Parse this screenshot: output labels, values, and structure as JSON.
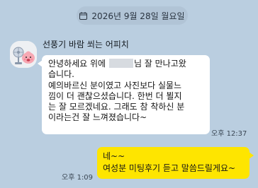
{
  "date_divider": {
    "icon": "calendar-icon",
    "text": "2026년 9월 28일 월요일"
  },
  "incoming": {
    "sender": "선풍기 바람 쐬는 어피치",
    "avatar_icon": "apeach-with-fan-avatar",
    "lines": [
      [
        "안녕하세요 위에",
        "님 잘 만나고왔"
      ],
      "습니다.",
      "예의바르신 분이였고 사진보다 실물느",
      "낌이 더 괜찮으셨습니다. 한번 더 뵐지",
      "는 잘 모르겠네요. 그래도 참 착하신 분",
      "이라는건 잘 느껴졌습니다~"
    ],
    "time": "오후 12:37"
  },
  "outgoing": {
    "lines": [
      "네~~",
      "여성분 미팅후기 듣고 말씀드릴게요~"
    ],
    "time": "오후 1:09"
  },
  "colors": {
    "background": "#bacee0",
    "incoming_bubble": "#ffffff",
    "outgoing_bubble": "#fee500"
  }
}
